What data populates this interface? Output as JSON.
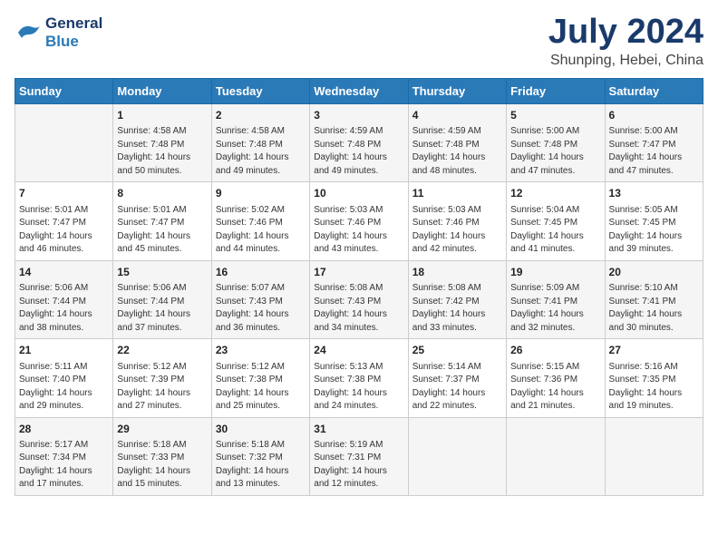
{
  "header": {
    "logo_line1": "General",
    "logo_line2": "Blue",
    "month_year": "July 2024",
    "location": "Shunping, Hebei, China"
  },
  "days_of_week": [
    "Sunday",
    "Monday",
    "Tuesday",
    "Wednesday",
    "Thursday",
    "Friday",
    "Saturday"
  ],
  "weeks": [
    [
      {
        "day": "",
        "info": ""
      },
      {
        "day": "1",
        "info": "Sunrise: 4:58 AM\nSunset: 7:48 PM\nDaylight: 14 hours\nand 50 minutes."
      },
      {
        "day": "2",
        "info": "Sunrise: 4:58 AM\nSunset: 7:48 PM\nDaylight: 14 hours\nand 49 minutes."
      },
      {
        "day": "3",
        "info": "Sunrise: 4:59 AM\nSunset: 7:48 PM\nDaylight: 14 hours\nand 49 minutes."
      },
      {
        "day": "4",
        "info": "Sunrise: 4:59 AM\nSunset: 7:48 PM\nDaylight: 14 hours\nand 48 minutes."
      },
      {
        "day": "5",
        "info": "Sunrise: 5:00 AM\nSunset: 7:48 PM\nDaylight: 14 hours\nand 47 minutes."
      },
      {
        "day": "6",
        "info": "Sunrise: 5:00 AM\nSunset: 7:47 PM\nDaylight: 14 hours\nand 47 minutes."
      }
    ],
    [
      {
        "day": "7",
        "info": "Sunrise: 5:01 AM\nSunset: 7:47 PM\nDaylight: 14 hours\nand 46 minutes."
      },
      {
        "day": "8",
        "info": "Sunrise: 5:01 AM\nSunset: 7:47 PM\nDaylight: 14 hours\nand 45 minutes."
      },
      {
        "day": "9",
        "info": "Sunrise: 5:02 AM\nSunset: 7:46 PM\nDaylight: 14 hours\nand 44 minutes."
      },
      {
        "day": "10",
        "info": "Sunrise: 5:03 AM\nSunset: 7:46 PM\nDaylight: 14 hours\nand 43 minutes."
      },
      {
        "day": "11",
        "info": "Sunrise: 5:03 AM\nSunset: 7:46 PM\nDaylight: 14 hours\nand 42 minutes."
      },
      {
        "day": "12",
        "info": "Sunrise: 5:04 AM\nSunset: 7:45 PM\nDaylight: 14 hours\nand 41 minutes."
      },
      {
        "day": "13",
        "info": "Sunrise: 5:05 AM\nSunset: 7:45 PM\nDaylight: 14 hours\nand 39 minutes."
      }
    ],
    [
      {
        "day": "14",
        "info": "Sunrise: 5:06 AM\nSunset: 7:44 PM\nDaylight: 14 hours\nand 38 minutes."
      },
      {
        "day": "15",
        "info": "Sunrise: 5:06 AM\nSunset: 7:44 PM\nDaylight: 14 hours\nand 37 minutes."
      },
      {
        "day": "16",
        "info": "Sunrise: 5:07 AM\nSunset: 7:43 PM\nDaylight: 14 hours\nand 36 minutes."
      },
      {
        "day": "17",
        "info": "Sunrise: 5:08 AM\nSunset: 7:43 PM\nDaylight: 14 hours\nand 34 minutes."
      },
      {
        "day": "18",
        "info": "Sunrise: 5:08 AM\nSunset: 7:42 PM\nDaylight: 14 hours\nand 33 minutes."
      },
      {
        "day": "19",
        "info": "Sunrise: 5:09 AM\nSunset: 7:41 PM\nDaylight: 14 hours\nand 32 minutes."
      },
      {
        "day": "20",
        "info": "Sunrise: 5:10 AM\nSunset: 7:41 PM\nDaylight: 14 hours\nand 30 minutes."
      }
    ],
    [
      {
        "day": "21",
        "info": "Sunrise: 5:11 AM\nSunset: 7:40 PM\nDaylight: 14 hours\nand 29 minutes."
      },
      {
        "day": "22",
        "info": "Sunrise: 5:12 AM\nSunset: 7:39 PM\nDaylight: 14 hours\nand 27 minutes."
      },
      {
        "day": "23",
        "info": "Sunrise: 5:12 AM\nSunset: 7:38 PM\nDaylight: 14 hours\nand 25 minutes."
      },
      {
        "day": "24",
        "info": "Sunrise: 5:13 AM\nSunset: 7:38 PM\nDaylight: 14 hours\nand 24 minutes."
      },
      {
        "day": "25",
        "info": "Sunrise: 5:14 AM\nSunset: 7:37 PM\nDaylight: 14 hours\nand 22 minutes."
      },
      {
        "day": "26",
        "info": "Sunrise: 5:15 AM\nSunset: 7:36 PM\nDaylight: 14 hours\nand 21 minutes."
      },
      {
        "day": "27",
        "info": "Sunrise: 5:16 AM\nSunset: 7:35 PM\nDaylight: 14 hours\nand 19 minutes."
      }
    ],
    [
      {
        "day": "28",
        "info": "Sunrise: 5:17 AM\nSunset: 7:34 PM\nDaylight: 14 hours\nand 17 minutes."
      },
      {
        "day": "29",
        "info": "Sunrise: 5:18 AM\nSunset: 7:33 PM\nDaylight: 14 hours\nand 15 minutes."
      },
      {
        "day": "30",
        "info": "Sunrise: 5:18 AM\nSunset: 7:32 PM\nDaylight: 14 hours\nand 13 minutes."
      },
      {
        "day": "31",
        "info": "Sunrise: 5:19 AM\nSunset: 7:31 PM\nDaylight: 14 hours\nand 12 minutes."
      },
      {
        "day": "",
        "info": ""
      },
      {
        "day": "",
        "info": ""
      },
      {
        "day": "",
        "info": ""
      }
    ]
  ]
}
